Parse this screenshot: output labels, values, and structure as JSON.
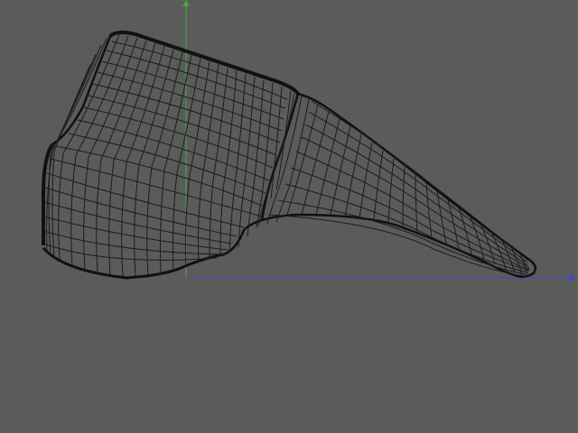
{
  "viewport": {
    "background_color": "#5b5b5b",
    "mode": "wireframe",
    "mesh_color": "#1a1a1a",
    "axes": {
      "x_axis_color": "#4444cc",
      "y_axis_color": "#44aa44"
    }
  }
}
